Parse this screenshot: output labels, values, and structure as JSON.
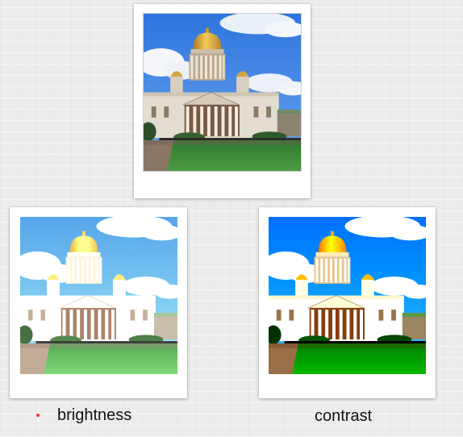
{
  "photos": [
    {
      "id": "original",
      "label": "",
      "scene": "cathedral-dome-photo"
    },
    {
      "id": "brightness",
      "label": "brightness",
      "scene": "cathedral-dome-photo-brightened"
    },
    {
      "id": "contrast",
      "label": "contrast",
      "scene": "cathedral-dome-photo-high-contrast"
    }
  ],
  "captions": {
    "brightness": "brightness",
    "contrast": "contrast"
  },
  "colors": {
    "bullet": "#e8393a",
    "sky": "#3b83e6",
    "dome_gold": "#d9a938",
    "grass": "#3f8a3a"
  }
}
